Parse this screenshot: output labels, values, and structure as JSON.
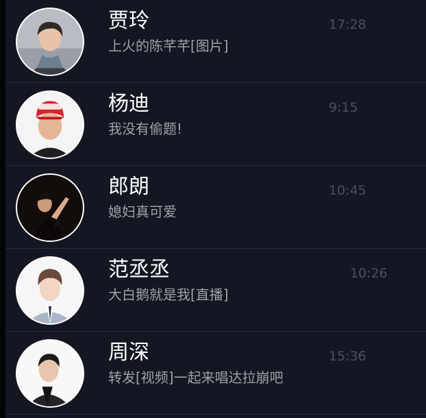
{
  "conversations": [
    {
      "name": "贾玲",
      "preview": "上火的陈芊芊[图片]",
      "time": "17:28",
      "avatar_icon": "person-avatar-icon"
    },
    {
      "name": "杨迪",
      "preview": "我没有偷题!",
      "time": "9:15",
      "avatar_icon": "person-avatar-icon"
    },
    {
      "name": "郎朗",
      "preview": "媳妇真可爱",
      "time": "10:45",
      "avatar_icon": "person-avatar-icon"
    },
    {
      "name": "范丞丞",
      "preview": "大白鹅就是我[直播]",
      "time": "10:26",
      "avatar_icon": "person-avatar-icon"
    },
    {
      "name": "周深",
      "preview": "转发[视频]一起来唱达拉崩吧",
      "time": "15:36",
      "avatar_icon": "person-avatar-icon"
    }
  ],
  "colors": {
    "background": "#141722",
    "name_text": "#ffffff",
    "preview_text": "#9ea1aa",
    "time_text": "#4c505c",
    "divider": "#2a2d38",
    "avatar_ring": "#ffffff"
  }
}
